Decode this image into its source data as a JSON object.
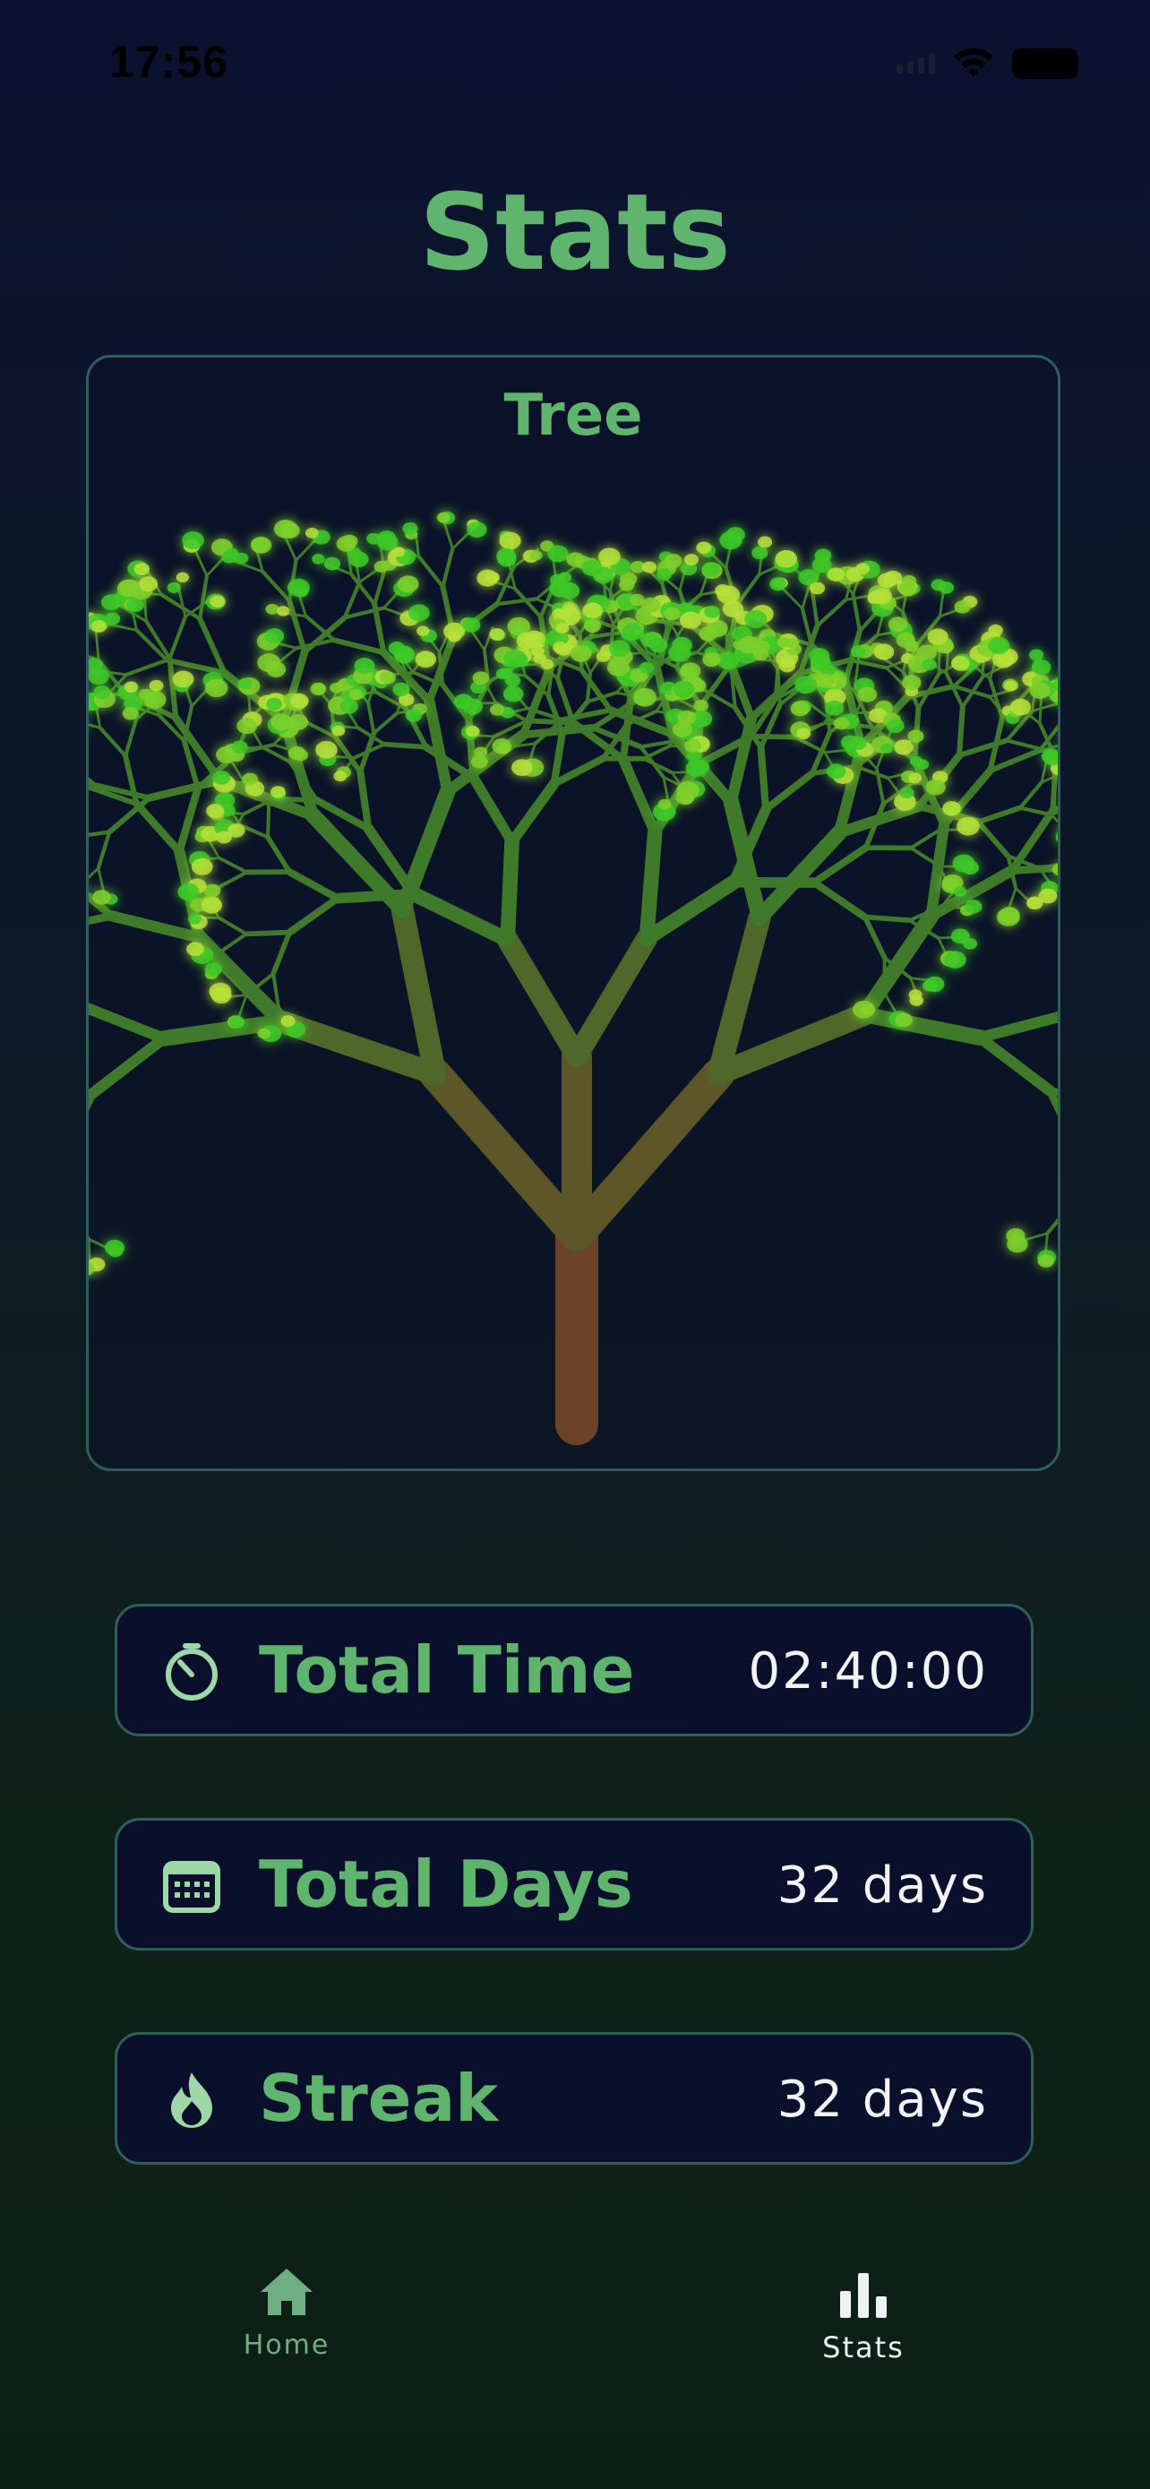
{
  "status_bar": {
    "time": "17:56"
  },
  "page": {
    "title": "Stats"
  },
  "tree_card": {
    "title": "Tree"
  },
  "stats": [
    {
      "label": "Total Time",
      "value": "02:40:00",
      "icon": "stopwatch-icon"
    },
    {
      "label": "Total Days",
      "value": "32 days",
      "icon": "calendar-icon"
    },
    {
      "label": "Streak",
      "value": "32 days",
      "icon": "flame-icon"
    }
  ],
  "tab_bar": {
    "items": [
      {
        "label": "Home",
        "icon": "home-icon",
        "active": false
      },
      {
        "label": "Stats",
        "icon": "bar-chart-icon",
        "active": true
      }
    ]
  },
  "colors": {
    "accent": "#5fb46e",
    "border": "#2e5f5a",
    "card_bg": "#0a0f2c",
    "value_text": "#f1f3f6",
    "trunk": "#6b4428",
    "leaf": "#4dbd2c"
  }
}
